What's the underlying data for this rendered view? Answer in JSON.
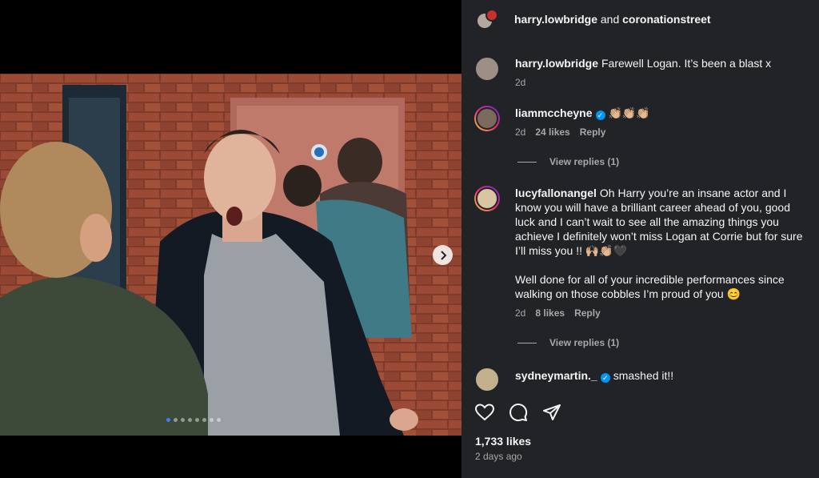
{
  "post": {
    "header": {
      "user1": "harry.lowbridge",
      "joiner": "and",
      "user2": "coronationstreet"
    },
    "comments": [
      {
        "user": "harry.lowbridge",
        "text": "Farewell Logan. It’s been a blast x",
        "age": "2d"
      },
      {
        "user": "liammccheyne",
        "text": "👏🏼👏🏼👏🏼",
        "age": "2d",
        "likes": "24 likes",
        "reply": "Reply",
        "view_replies": "View replies (1)"
      },
      {
        "user": "lucyfallonangel",
        "text": "Oh Harry you’re an insane actor and I know you will have a brilliant career ahead of you, good luck and I can’t wait to see all the amazing things you achieve I definitely won’t miss Logan at Corrie but for sure I’ll miss you !! 🙌🏼👏🏼🖤",
        "text2": "Well done for all of your incredible performances since walking on those cobbles I’m proud of you 😊",
        "age": "2d",
        "likes": "8 likes",
        "reply": "Reply",
        "view_replies": "View replies (1)"
      },
      {
        "user": "sydneymartin._",
        "text": "smashed it!!"
      }
    ],
    "likes": "1,733 likes",
    "age": "2 days ago"
  },
  "media": {
    "slide_count": 8,
    "active_index": 0
  },
  "colors": {
    "panel": "#222326",
    "accent": "#0095f6",
    "muted": "#a8a8a8"
  }
}
